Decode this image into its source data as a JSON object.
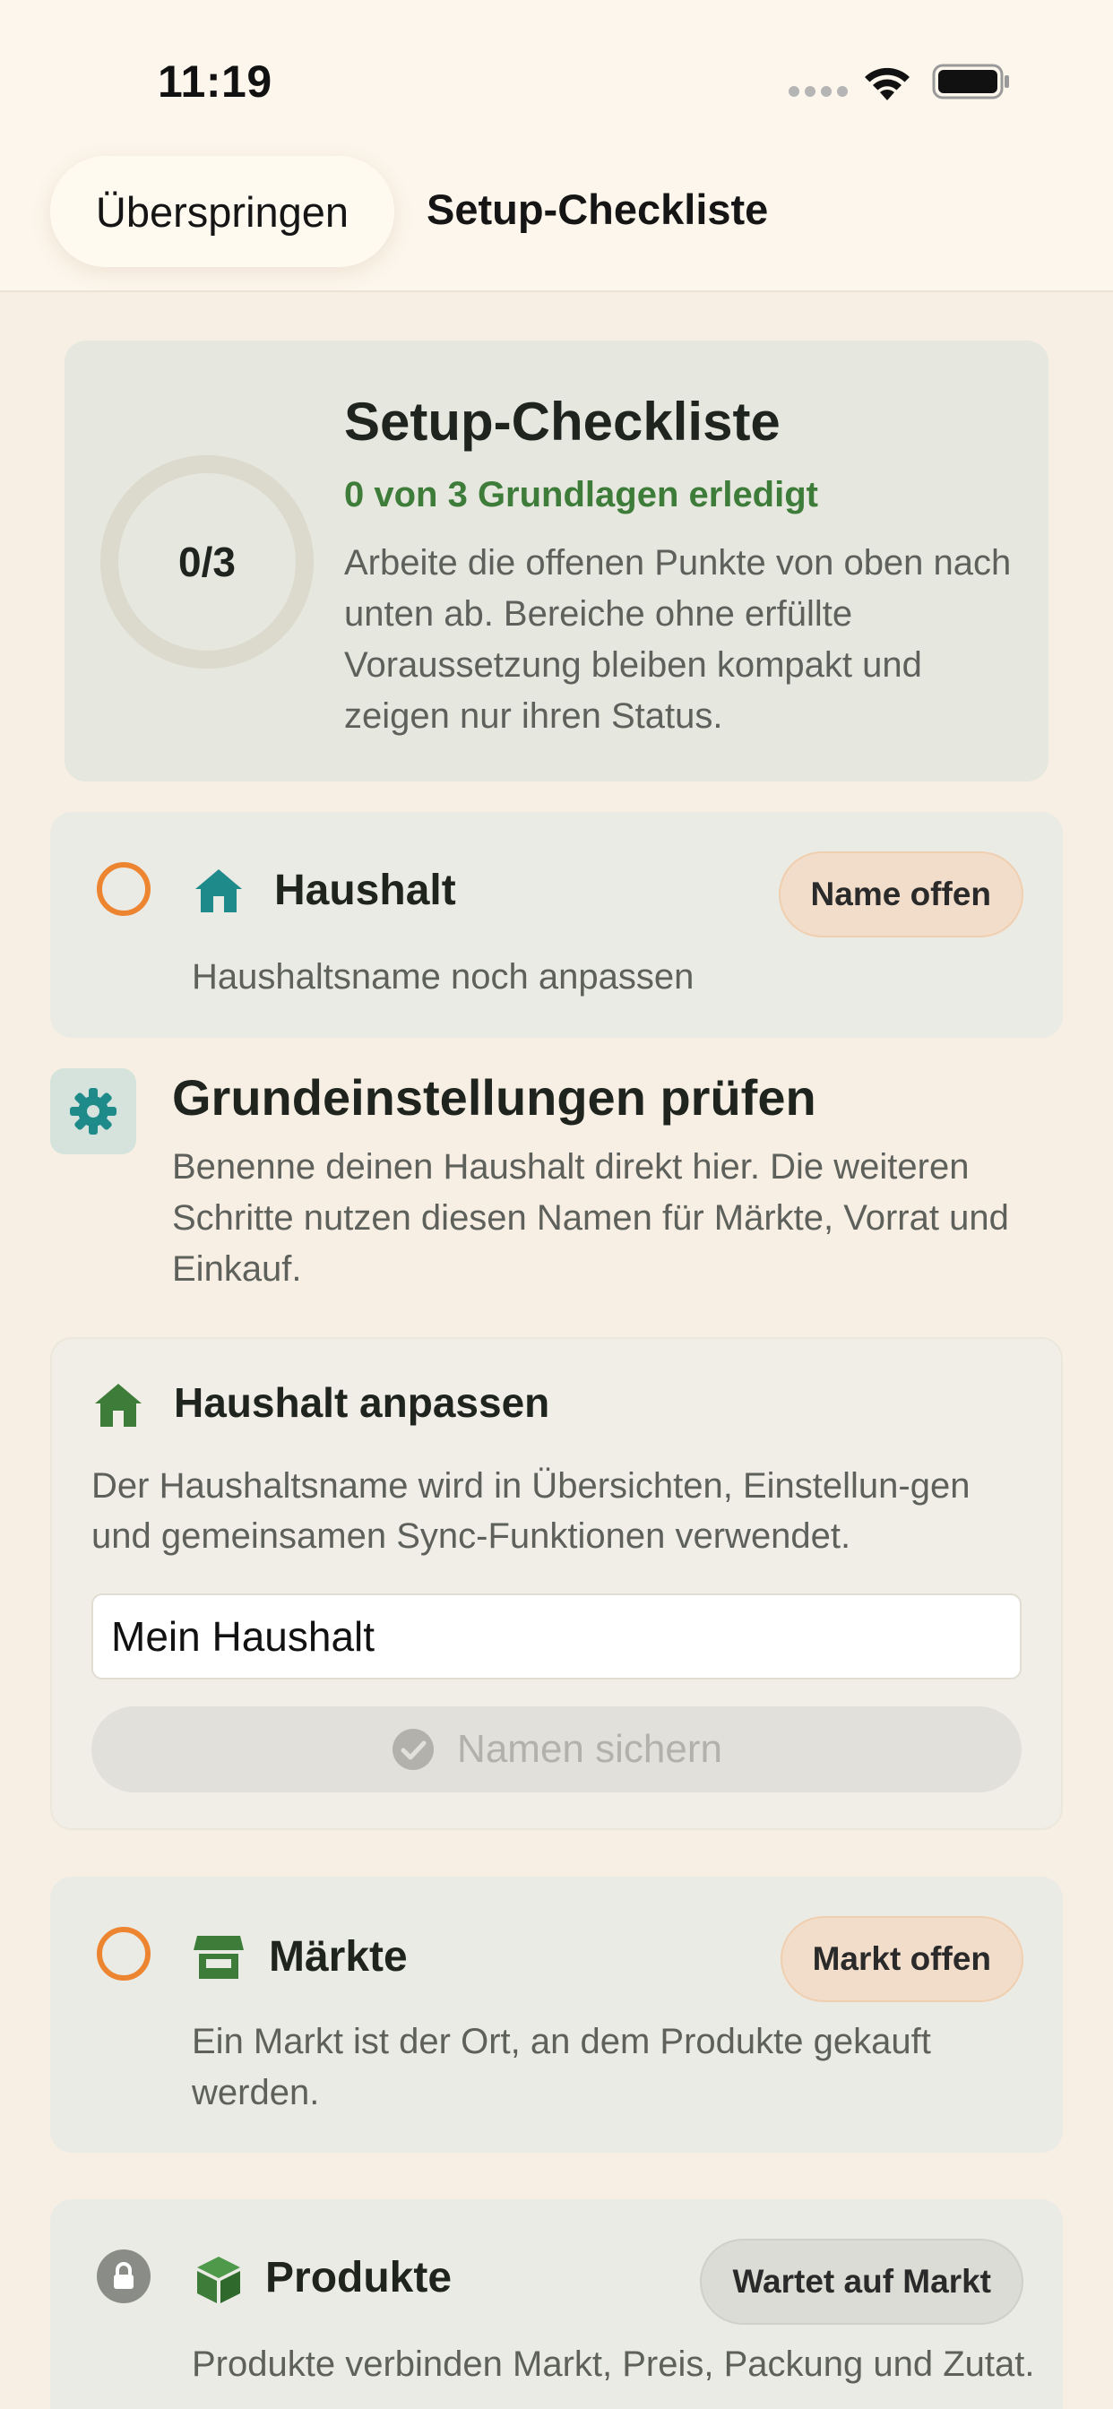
{
  "status_bar": {
    "time": "11:19"
  },
  "nav": {
    "skip_label": "Überspringen",
    "title": "Setup-Checkliste"
  },
  "summary": {
    "progress_ring": "0/3",
    "completed": 0,
    "total": 3,
    "title": "Setup-Checkliste",
    "progress_text": "0 von 3 Grundlagen erledigt",
    "description": "Arbeite die offenen Punkte von oben nach unten ab. Bereiche ohne erfüllte Voraussetzung bleiben kompakt und zeigen nur ihren Status."
  },
  "steps": [
    {
      "title": "Haushalt",
      "badge": "Name offen",
      "description": "Haushaltsname noch anpassen",
      "state": "open",
      "icon": "house-icon"
    },
    {
      "title": "Märkte",
      "badge": "Markt offen",
      "description": "Ein Markt ist der Ort, an dem Produkte gekauft werden.",
      "state": "open",
      "icon": "store-icon"
    },
    {
      "title": "Produkte",
      "badge": "Wartet auf Markt",
      "description": "Produkte verbinden Markt, Preis, Packung und Zutat.",
      "state": "locked",
      "icon": "box-icon"
    }
  ],
  "settings_section": {
    "title": "Grundeinstellungen prüfen",
    "description": "Benenne deinen Haushalt direkt hier. Die weiteren Schritte nutzen diesen Namen für Märkte, Vorrat und Einkauf."
  },
  "household_edit": {
    "title": "Haushalt anpassen",
    "description": "Der Haushaltsname wird in Übersichten, Einstellun-gen und gemeinsamen Sync-Funktionen verwendet.",
    "input_value": "Mein Haushalt",
    "save_label": "Namen sichern"
  },
  "colors": {
    "background": "#f7efe3",
    "accent_green": "#3e7c3a",
    "accent_teal": "#1e8a8a",
    "open_orange": "#ec8430"
  }
}
